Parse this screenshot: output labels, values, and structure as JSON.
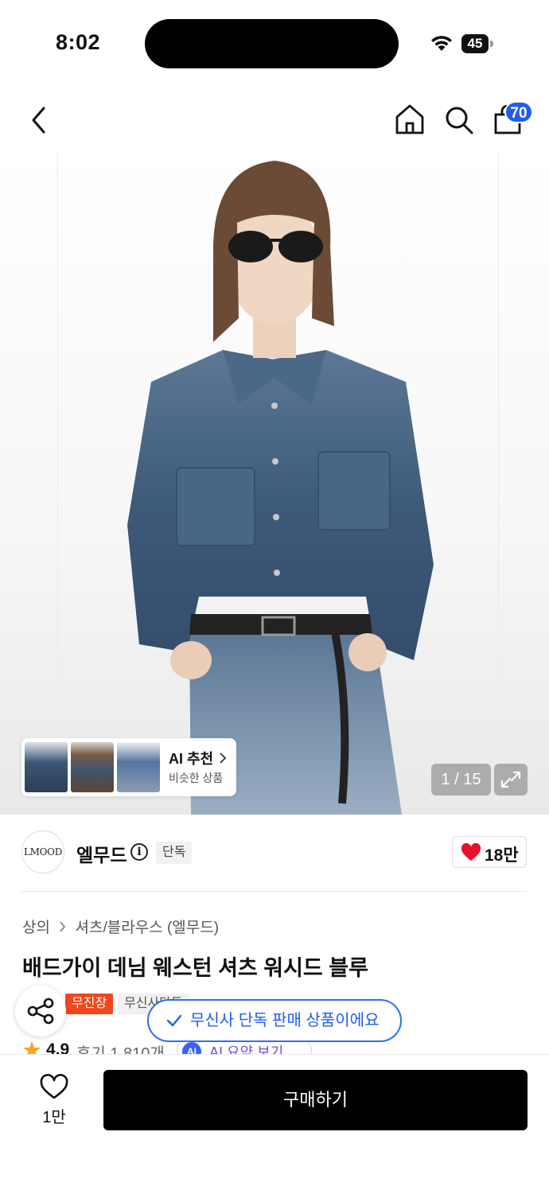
{
  "status_bar": {
    "time": "8:02",
    "battery": "45"
  },
  "header": {
    "cart_count": "70"
  },
  "gallery": {
    "ai_recommend": {
      "title": "AI 추천",
      "subtitle": "비슷한 상품"
    },
    "page_indicator": "1 / 15"
  },
  "brand": {
    "logo_text": "LMOOD",
    "name": "엘무드",
    "badge": "단독",
    "like_count": "18만"
  },
  "product": {
    "breadcrumb": [
      "상의",
      "셔츠/블라우스 (엘무드)"
    ],
    "title": "배드가이 데님 웨스턴 셔츠 워시드 블루",
    "tags": [
      "무진장",
      "무신사단독"
    ],
    "rating": "4.9",
    "reviews": "후기 1,810개",
    "ai_summary": "AI 요약 보기",
    "ai_dot": "AI"
  },
  "toast": {
    "message": "무신사 단독 판매 상품이에요"
  },
  "bottom_bar": {
    "wish_count": "1만",
    "buy_label": "구매하기"
  },
  "colors": {
    "accent_blue": "#1f5cf0",
    "tag_orange": "#f2461d",
    "heart_red": "#e8102a",
    "buy_button": "#000000"
  }
}
